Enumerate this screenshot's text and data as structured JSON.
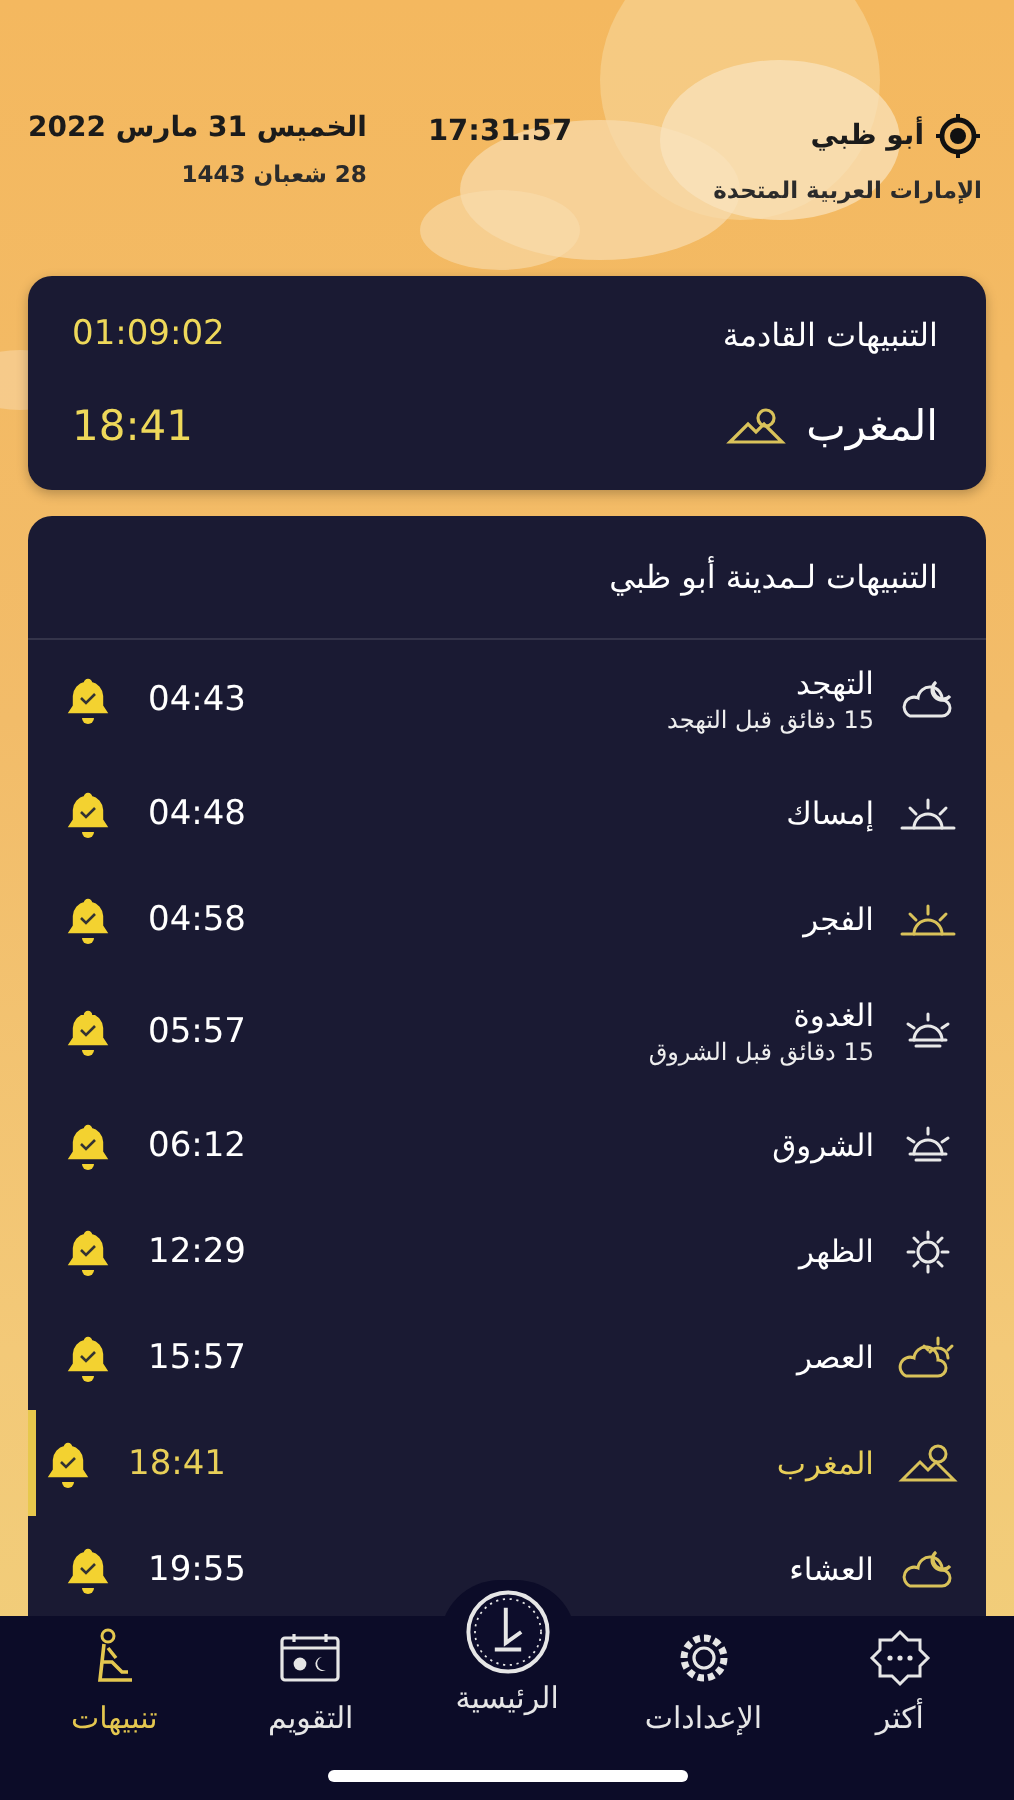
{
  "header": {
    "city": "أبو ظبي",
    "country": "الإمارات العربية المتحدة",
    "clock": "17:31:57",
    "date": "الخميس 31 مارس 2022",
    "hijri_date": "28 شعبان 1443"
  },
  "next_alert": {
    "title": "التنبيهات القادمة",
    "countdown": "01:09:02",
    "name": "المغرب",
    "kind": "sunset",
    "time": "18:41"
  },
  "alerts": {
    "title": "التنبيهات لـمدينة أبو ظبي",
    "rows": [
      {
        "kind": "night",
        "name": "التهجد",
        "note": "15 دقائق قبل التهجد",
        "time": "04:43",
        "alarm": true,
        "selected": false
      },
      {
        "kind": "dawn",
        "name": "إمساك",
        "time": "04:48",
        "alarm": true,
        "selected": false
      },
      {
        "kind": "fajr",
        "name": "الفجر",
        "time": "04:58",
        "alarm": true,
        "selected": false
      },
      {
        "kind": "sunrise",
        "name": "الغدوة",
        "note": "15 دقائق قبل الشروق",
        "time": "05:57",
        "alarm": true,
        "selected": false
      },
      {
        "kind": "sunrise",
        "name": "الشروق",
        "time": "06:12",
        "alarm": true,
        "selected": false
      },
      {
        "kind": "noon",
        "name": "الظهر",
        "time": "12:29",
        "alarm": true,
        "selected": false
      },
      {
        "kind": "afternoon",
        "name": "العصر",
        "time": "15:57",
        "alarm": true,
        "selected": false
      },
      {
        "kind": "sunset",
        "name": "المغرب",
        "time": "18:41",
        "alarm": true,
        "selected": true
      },
      {
        "kind": "evening",
        "name": "العشاء",
        "time": "19:55",
        "alarm": true,
        "selected": false
      }
    ]
  },
  "tab_bar": [
    {
      "kind": "more",
      "label": "أكثر",
      "selected": false
    },
    {
      "kind": "settings",
      "label": "الإعدادات",
      "selected": false
    },
    {
      "kind": "home",
      "label": "الرئيسية",
      "selected": false
    },
    {
      "kind": "calendar",
      "label": "التقويم",
      "selected": false
    },
    {
      "kind": "alerts",
      "label": "تنبيهات",
      "selected": true
    }
  ]
}
